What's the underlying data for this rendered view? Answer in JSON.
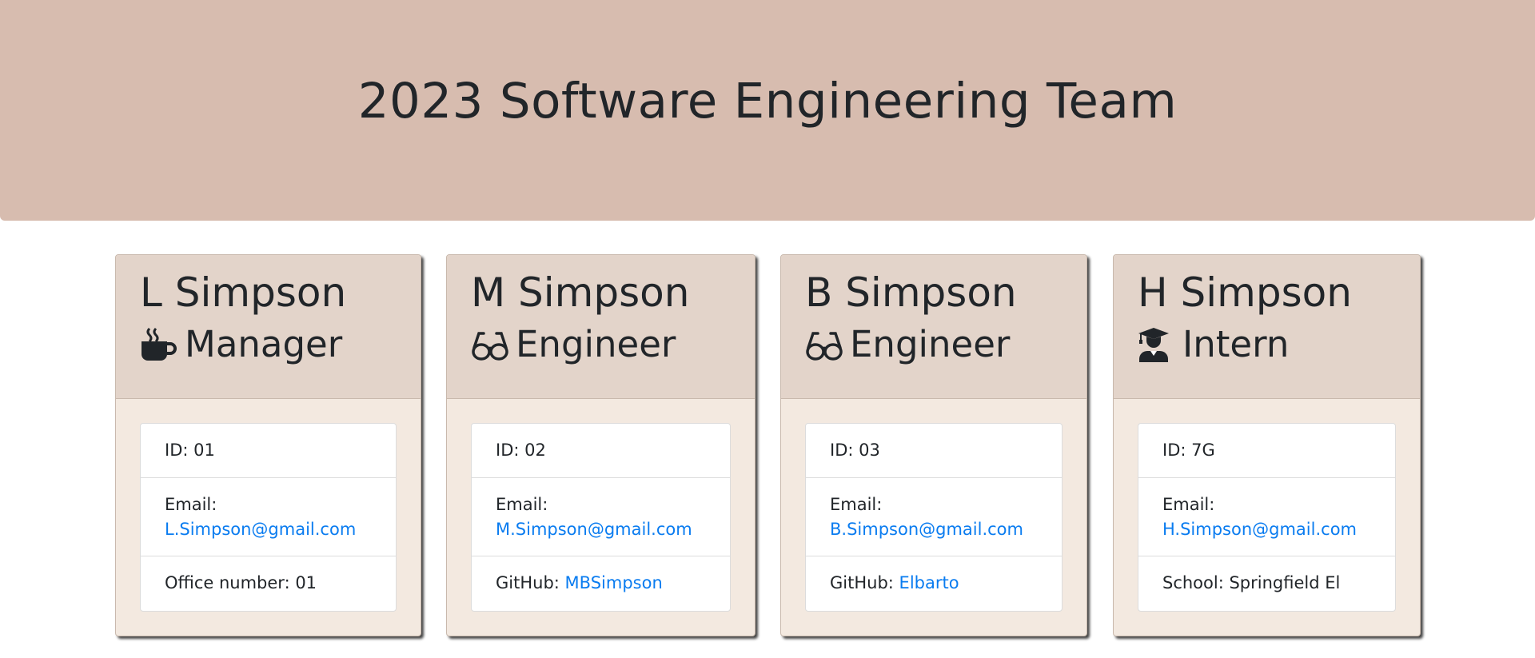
{
  "header": {
    "title": "2023 Software Engineering Team"
  },
  "icons": {
    "manager": "coffee-mug-icon",
    "engineer": "glasses-icon",
    "intern": "graduate-icon"
  },
  "cards": [
    {
      "name": "L Simpson",
      "role": "Manager",
      "id_label": "ID: 01",
      "email_label": "Email:",
      "email": "L.Simpson@gmail.com",
      "extra_label": "Office number: 01",
      "extra_link": ""
    },
    {
      "name": "M Simpson",
      "role": "Engineer",
      "id_label": "ID: 02",
      "email_label": "Email:",
      "email": "M.Simpson@gmail.com",
      "extra_label": "GitHub:",
      "extra_link": "MBSimpson"
    },
    {
      "name": "B Simpson",
      "role": "Engineer",
      "id_label": "ID: 03",
      "email_label": "Email:",
      "email": "B.Simpson@gmail.com",
      "extra_label": "GitHub:",
      "extra_link": "Elbarto"
    },
    {
      "name": "H Simpson",
      "role": "Intern",
      "id_label": "ID: 7G",
      "email_label": "Email:",
      "email": "H.Simpson@gmail.com",
      "extra_label": "School: Springfield El",
      "extra_link": ""
    }
  ]
}
